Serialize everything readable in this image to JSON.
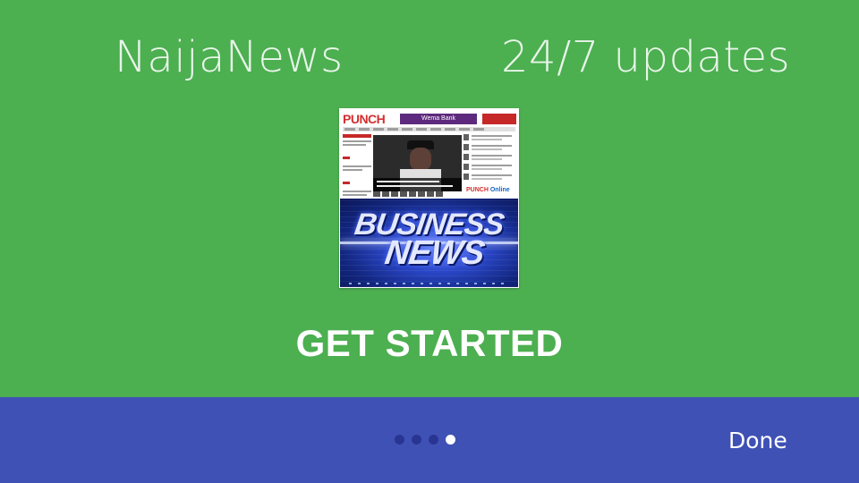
{
  "slide": {
    "title_left": "NaijaNews",
    "title_right": "24/7 updates",
    "cta_label": "GET STARTED",
    "background_color": "#4caf50"
  },
  "preview_image": {
    "newspaper_logo": "PUNCH",
    "ad_text": "Wema Bank",
    "online_brand": "PUNCH",
    "online_brand_suffix": "Online",
    "banner_line1": "BUSINESS",
    "banner_line2": "NEWS"
  },
  "footer": {
    "background_color": "#3f51b5",
    "done_label": "Done",
    "page_indicator": {
      "total": 4,
      "current": 4
    }
  }
}
